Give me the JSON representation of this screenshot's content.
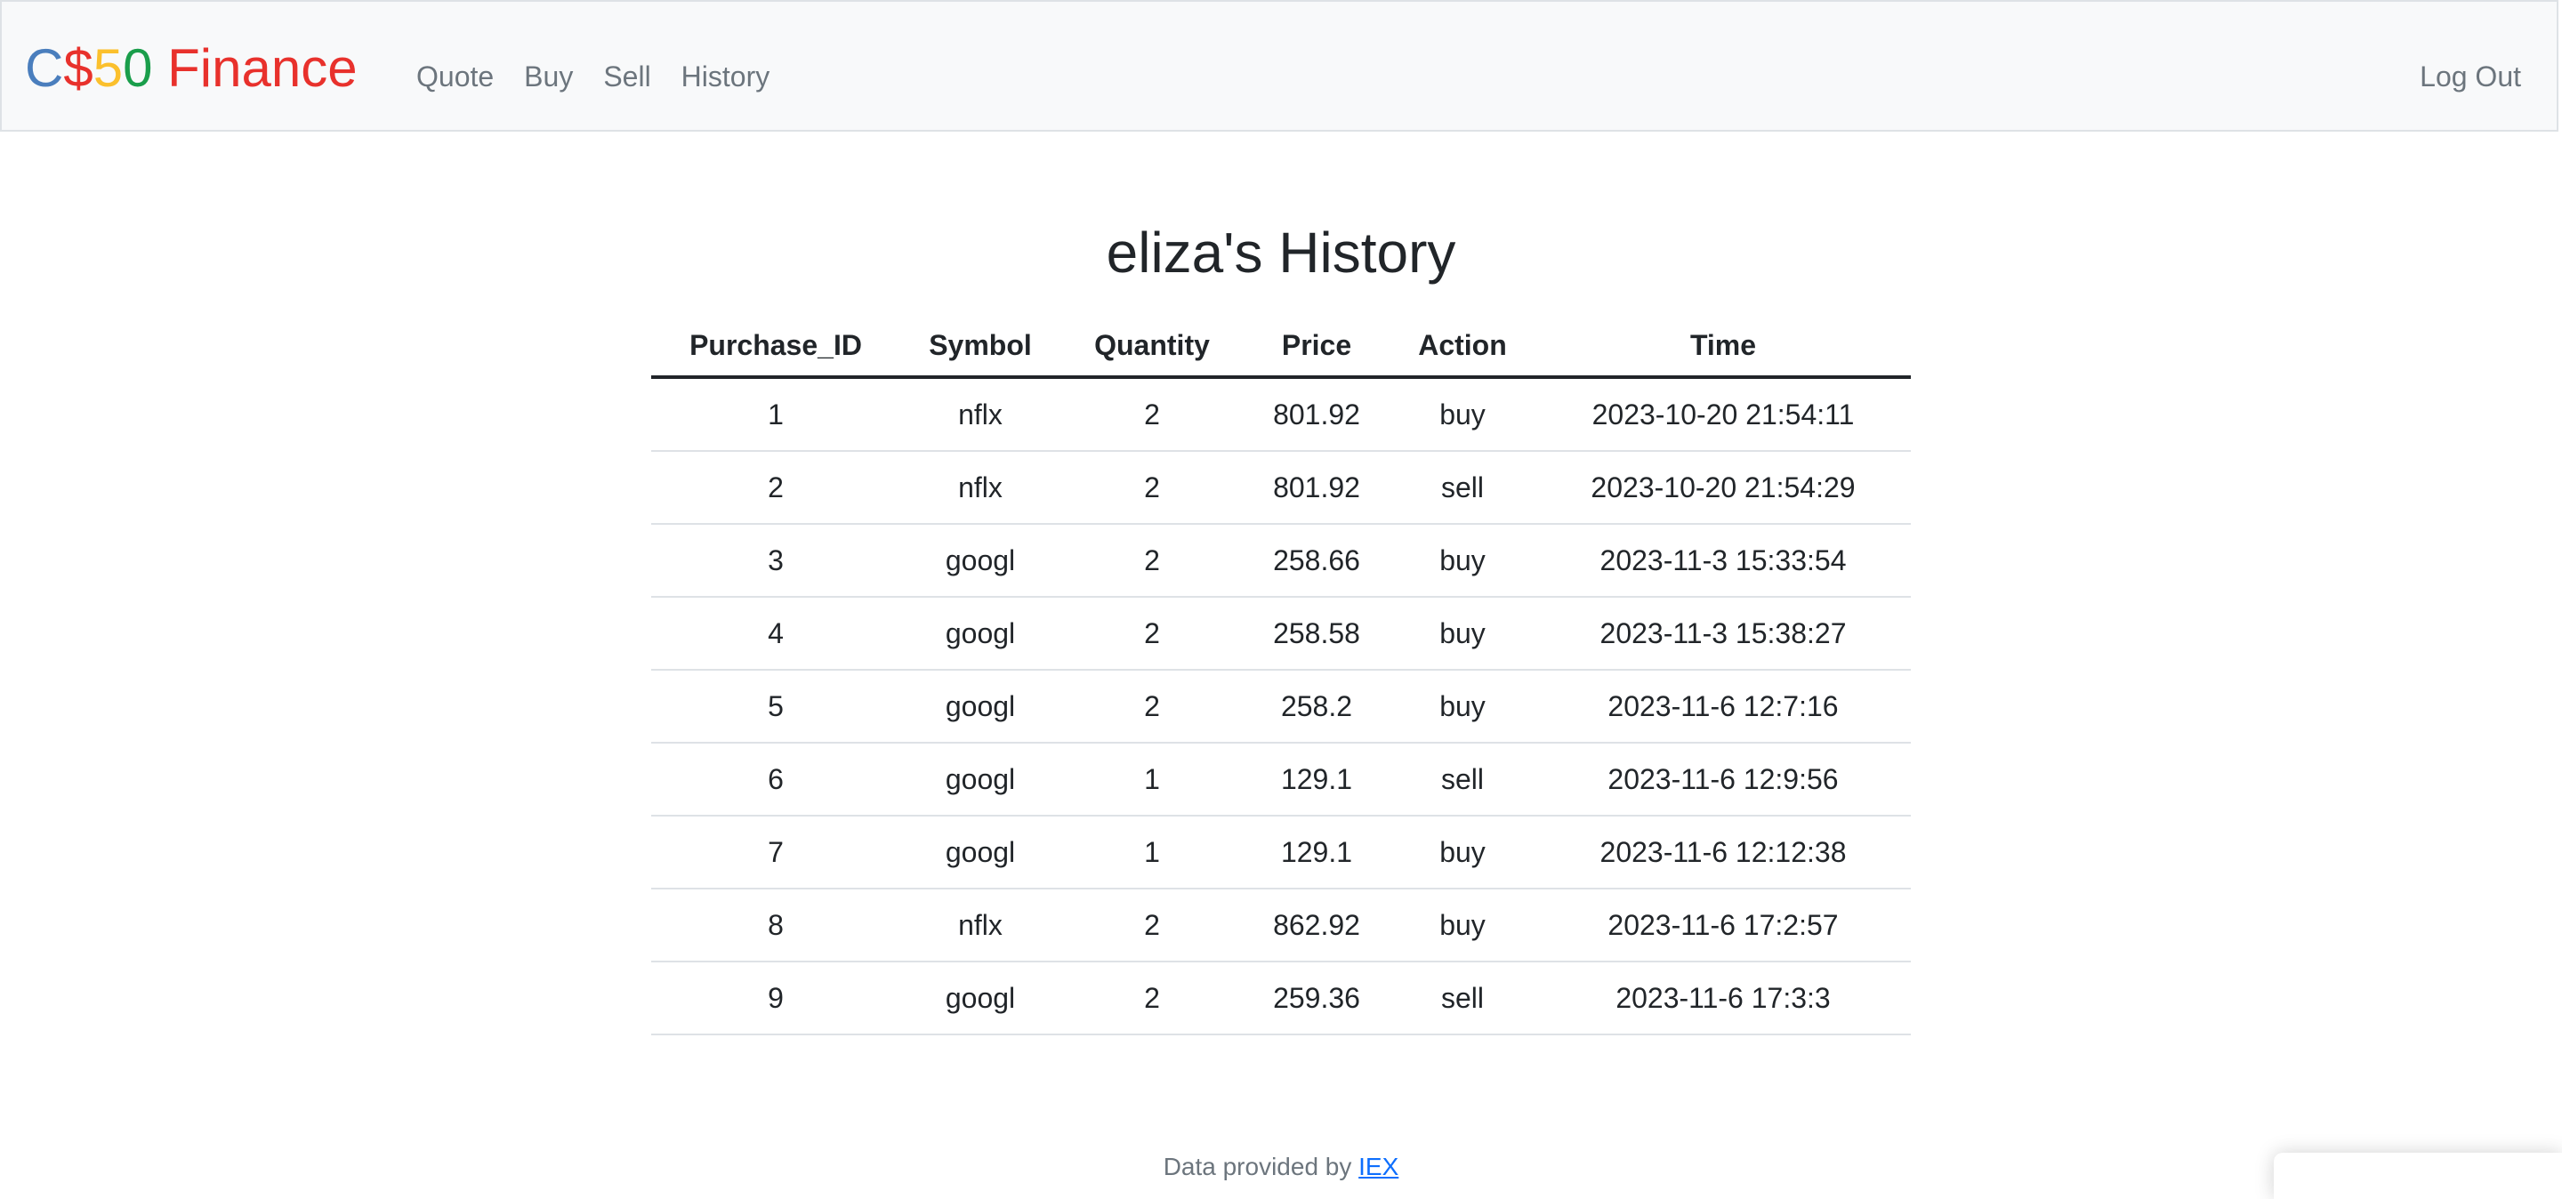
{
  "nav": {
    "brand": {
      "c": "C",
      "dollar": "$",
      "five": "5",
      "zero": "0",
      "finance": " Finance"
    },
    "links": [
      "Quote",
      "Buy",
      "Sell",
      "History"
    ],
    "logout": "Log Out"
  },
  "page": {
    "title": "eliza's History"
  },
  "table": {
    "headers": [
      "Purchase_ID",
      "Symbol",
      "Quantity",
      "Price",
      "Action",
      "Time"
    ],
    "rows": [
      [
        "1",
        "nflx",
        "2",
        "801.92",
        "buy",
        "2023-10-20 21:54:11"
      ],
      [
        "2",
        "nflx",
        "2",
        "801.92",
        "sell",
        "2023-10-20 21:54:29"
      ],
      [
        "3",
        "googl",
        "2",
        "258.66",
        "buy",
        "2023-11-3 15:33:54"
      ],
      [
        "4",
        "googl",
        "2",
        "258.58",
        "buy",
        "2023-11-3 15:38:27"
      ],
      [
        "5",
        "googl",
        "2",
        "258.2",
        "buy",
        "2023-11-6 12:7:16"
      ],
      [
        "6",
        "googl",
        "1",
        "129.1",
        "sell",
        "2023-11-6 12:9:56"
      ],
      [
        "7",
        "googl",
        "1",
        "129.1",
        "buy",
        "2023-11-6 12:12:38"
      ],
      [
        "8",
        "nflx",
        "2",
        "862.92",
        "buy",
        "2023-11-6 17:2:57"
      ],
      [
        "9",
        "googl",
        "2",
        "259.36",
        "sell",
        "2023-11-6 17:3:3"
      ]
    ]
  },
  "footer": {
    "text": "Data provided by ",
    "link": "IEX"
  },
  "colors": {
    "brand_c": "#4a7ebd",
    "brand_dollar": "#e8312c",
    "brand_five": "#fbc02d",
    "brand_zero": "#1a9e4b",
    "brand_finance": "#e8312c",
    "link": "#0d6efd"
  }
}
